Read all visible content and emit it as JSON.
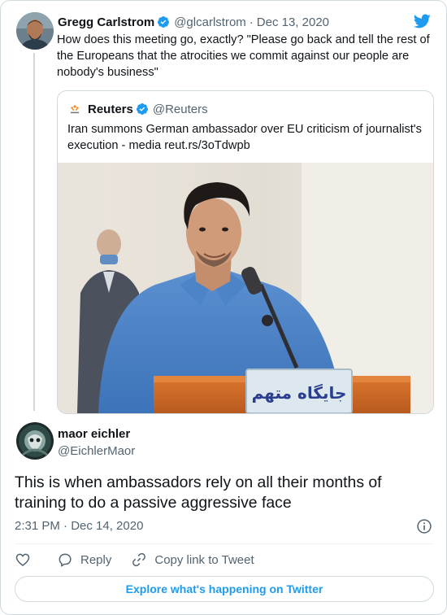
{
  "parent_tweet": {
    "author_name": "Gregg Carlstrom",
    "handle": "@glcarlstrom",
    "separator": "·",
    "date": "Dec 13, 2020",
    "text": "How does this meeting go, exactly? \"Please go back and tell the rest of the Europeans that the atrocities we commit against our people are nobody's business\"",
    "avatar_icon": "profile-photo-man",
    "verified_icon": "verified-badge-icon",
    "brand_icon": "twitter-bird-icon"
  },
  "quoted_tweet": {
    "author_name": "Reuters",
    "handle": "@Reuters",
    "logo_icon": "reuters-logo-icon",
    "verified_icon": "verified-badge-icon",
    "text": "Iran summons German ambassador over EU criticism of journalist's execution - media reut.rs/3oTdwpb",
    "image": {
      "icon": "courtroom-photo",
      "placard_text": "جایگاه متهم"
    }
  },
  "main_tweet": {
    "author_name": "maor eichler",
    "handle": "@EichlerMaor",
    "avatar_icon": "profile-photo-dark",
    "text": "This is when ambassadors rely on all their months of training to do a passive aggressive face",
    "timestamp": "2:31 PM · Dec 14, 2020",
    "info_icon": "info-circle-icon"
  },
  "actions": {
    "like_icon": "heart-icon",
    "reply_icon": "speech-bubble-icon",
    "reply_label": "Reply",
    "copy_icon": "link-icon",
    "copy_label": "Copy link to Tweet"
  },
  "explore_button": {
    "label": "Explore what's happening on Twitter"
  },
  "colors": {
    "accent": "#1d9bf0",
    "text": "#0f1419",
    "secondary": "#536471",
    "border": "#cfd9de"
  }
}
